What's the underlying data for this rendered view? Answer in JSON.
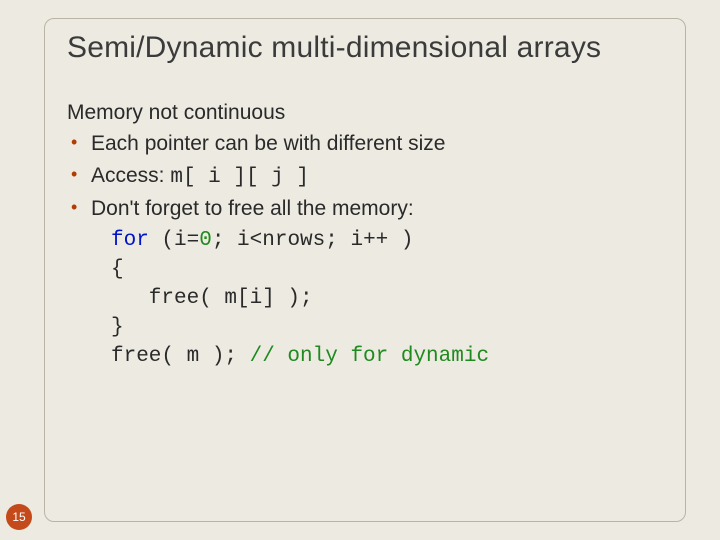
{
  "title": "Semi/Dynamic multi-dimensional arrays",
  "lead": "Memory not continuous",
  "bullets": [
    {
      "text": "Each pointer can be with different size"
    },
    {
      "prefix": "Access: ",
      "code": "m[ i ][ j ]"
    },
    {
      "text": "Don't forget to free all the memory:"
    }
  ],
  "code": {
    "l1_kw": "for",
    "l1_a": " (i=",
    "l1_num": "0",
    "l1_b": "; i<nrows; i++ )",
    "l2": "{",
    "l3": "   free( m[i] );",
    "l4": "}",
    "l5_a": "free( m ); ",
    "l5_cmt": "// only for dynamic"
  },
  "page": "15"
}
